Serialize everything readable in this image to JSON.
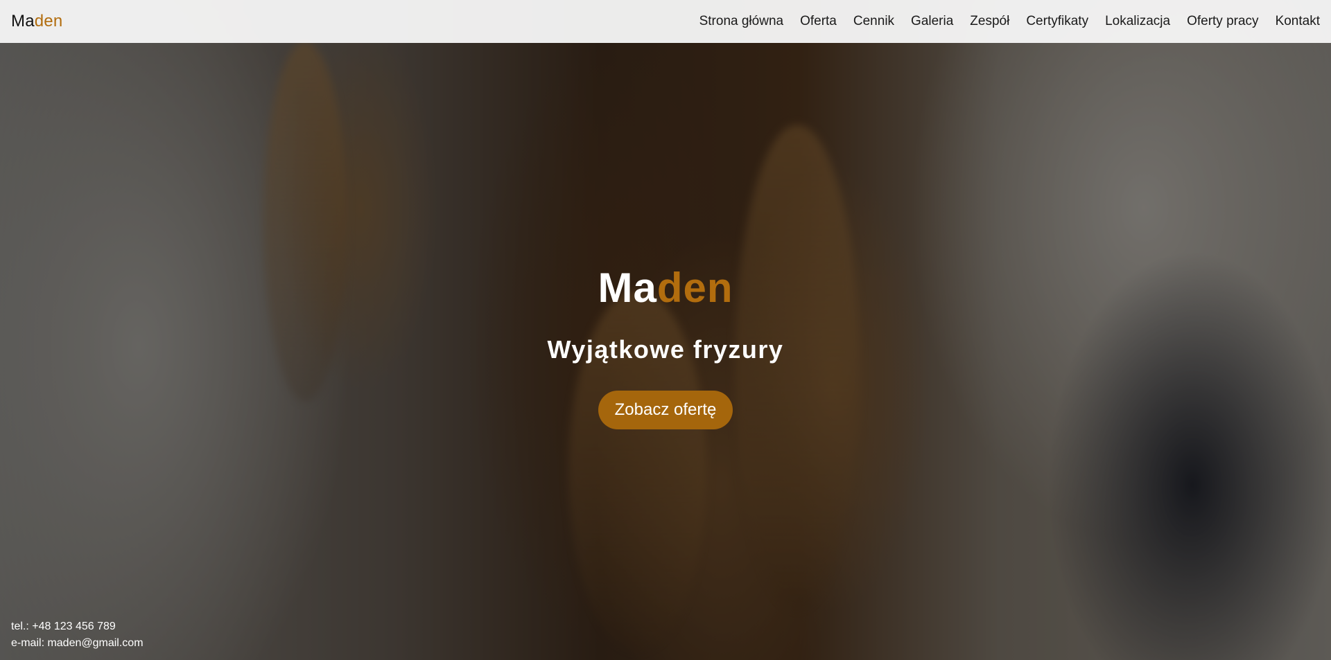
{
  "brand": {
    "prefix": "Ma",
    "suffix": "den"
  },
  "nav": {
    "items": [
      {
        "label": "Strona główna"
      },
      {
        "label": "Oferta"
      },
      {
        "label": "Cennik"
      },
      {
        "label": "Galeria"
      },
      {
        "label": "Zespół"
      },
      {
        "label": "Certyfikaty"
      },
      {
        "label": "Lokalizacja"
      },
      {
        "label": "Oferty pracy"
      },
      {
        "label": "Kontakt"
      }
    ]
  },
  "hero": {
    "title_prefix": "Ma",
    "title_suffix": "den",
    "subtitle": "Wyjątkowe fryzury",
    "cta_label": "Zobacz ofertę"
  },
  "contact": {
    "phone": "tel.: +48 123 456 789",
    "email": "e-mail: maden@gmail.com"
  },
  "colors": {
    "accent": "#b26d0e",
    "cta_background": "#a5660c",
    "navbar_background": "#f5f5f5"
  }
}
